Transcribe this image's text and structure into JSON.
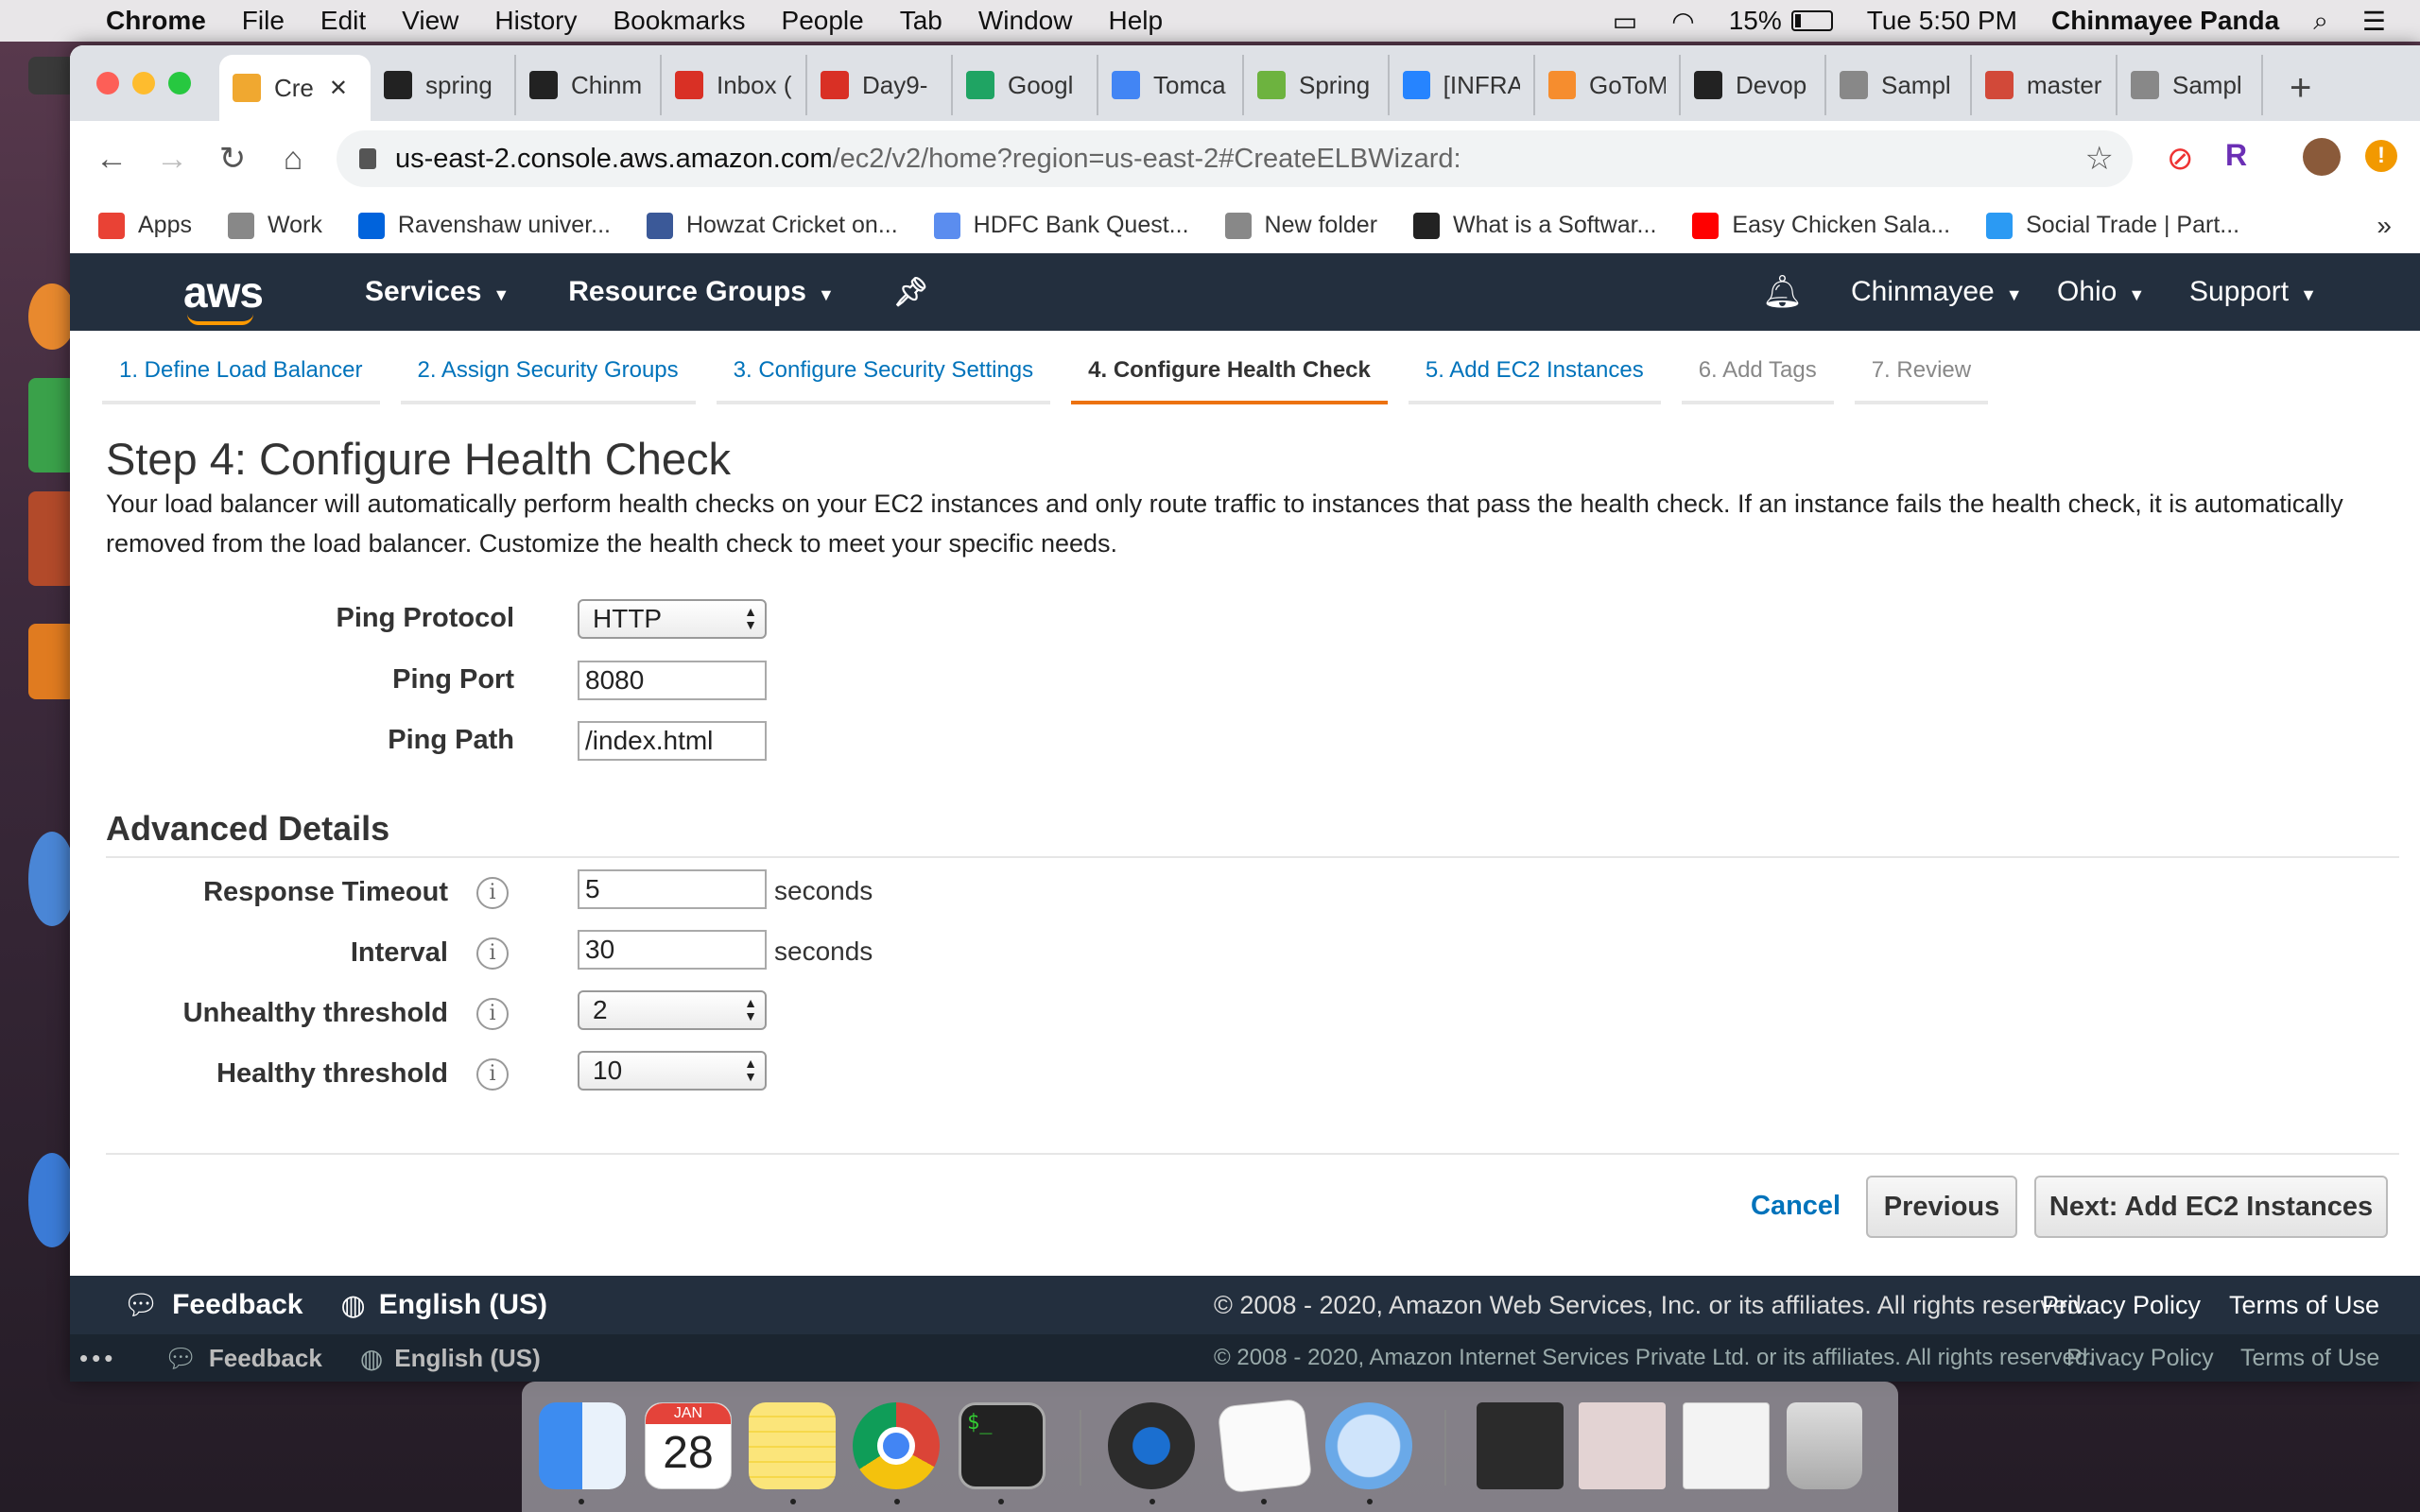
{
  "menubar": {
    "app": "Chrome",
    "items": [
      "File",
      "Edit",
      "View",
      "History",
      "Bookmarks",
      "People",
      "Tab",
      "Window",
      "Help"
    ],
    "battery": "15%",
    "clock": "Tue 5:50 PM",
    "user": "Chinmayee Panda"
  },
  "tabs": [
    {
      "label": "Cre",
      "icon": "aws-icon",
      "color": "#f0a830"
    },
    {
      "label": "spring",
      "icon": "github-icon",
      "color": "#222"
    },
    {
      "label": "Chinm",
      "icon": "github-icon",
      "color": "#222"
    },
    {
      "label": "Inbox (",
      "icon": "gmail-icon",
      "color": "#d93025"
    },
    {
      "label": "Day9-",
      "icon": "calendar-icon",
      "color": "#d93025"
    },
    {
      "label": "Googl",
      "icon": "drive-icon",
      "color": "#1fa463"
    },
    {
      "label": "Tomca",
      "icon": "docs-icon",
      "color": "#4285f4"
    },
    {
      "label": "Spring",
      "icon": "spring-icon",
      "color": "#6db33f"
    },
    {
      "label": "[INFRA",
      "icon": "jira-icon",
      "color": "#2684ff"
    },
    {
      "label": "GoToM",
      "icon": "gotomeeting-icon",
      "color": "#f68d2e"
    },
    {
      "label": "Devop",
      "icon": "github-icon",
      "color": "#222"
    },
    {
      "label": "Sampl",
      "icon": "jenkins-icon",
      "color": "#888"
    },
    {
      "label": "master",
      "icon": "jenkins-icon",
      "color": "#d24939"
    },
    {
      "label": "Sampl",
      "icon": "jenkins-icon",
      "color": "#888"
    }
  ],
  "address": {
    "host": "us-east-2.console.aws.amazon.com",
    "path": "/ec2/v2/home?region=us-east-2#CreateELBWizard:"
  },
  "bookmarks": [
    {
      "label": "Apps",
      "icon": "apps-grid-icon",
      "color": "#e94235"
    },
    {
      "label": "Work",
      "icon": "folder-icon",
      "color": "#888"
    },
    {
      "label": "Ravenshaw univer...",
      "icon": "flickr-icon",
      "color": "#0063dc"
    },
    {
      "label": "Howzat Cricket on...",
      "icon": "facebook-icon",
      "color": "#3b5998"
    },
    {
      "label": "HDFC Bank Quest...",
      "icon": "b-icon",
      "color": "#5b8def"
    },
    {
      "label": "New folder",
      "icon": "folder-icon",
      "color": "#888"
    },
    {
      "label": "What is a Softwar...",
      "icon": "bookmark-site-icon",
      "color": "#222"
    },
    {
      "label": "Easy Chicken Sala...",
      "icon": "youtube-icon",
      "color": "#ff0000"
    },
    {
      "label": "Social Trade | Part...",
      "icon": "s-icon",
      "color": "#2b9af3"
    }
  ],
  "aws": {
    "logo": "aws",
    "services": "Services",
    "resource_groups": "Resource Groups",
    "account": "Chinmayee",
    "region": "Ohio",
    "support": "Support"
  },
  "steps": [
    {
      "label": "1. Define Load Balancer",
      "state": "link"
    },
    {
      "label": "2. Assign Security Groups",
      "state": "link"
    },
    {
      "label": "3. Configure Security Settings",
      "state": "link"
    },
    {
      "label": "4. Configure Health Check",
      "state": "active"
    },
    {
      "label": "5. Add EC2 Instances",
      "state": "link"
    },
    {
      "label": "6. Add Tags",
      "state": "disabled"
    },
    {
      "label": "7. Review",
      "state": "disabled"
    }
  ],
  "page": {
    "title": "Step 4: Configure Health Check",
    "description": "Your load balancer will automatically perform health checks on your EC2 instances and only route traffic to instances that pass the health check. If an instance fails the health check, it is automatically removed from the load balancer. Customize the health check to meet your specific needs."
  },
  "form": {
    "ping_protocol_label": "Ping Protocol",
    "ping_protocol_value": "HTTP",
    "ping_port_label": "Ping Port",
    "ping_port_value": "8080",
    "ping_path_label": "Ping Path",
    "ping_path_value": "/index.html"
  },
  "advanced": {
    "heading": "Advanced Details",
    "response_timeout_label": "Response Timeout",
    "response_timeout_value": "5",
    "interval_label": "Interval",
    "interval_value": "30",
    "unhealthy_label": "Unhealthy threshold",
    "unhealthy_value": "2",
    "healthy_label": "Healthy threshold",
    "healthy_value": "10",
    "unit": "seconds",
    "info": "i"
  },
  "buttons": {
    "cancel": "Cancel",
    "previous": "Previous",
    "next": "Next: Add EC2 Instances"
  },
  "footer": {
    "feedback": "Feedback",
    "language": "English (US)",
    "copyright": "© 2008 - 2020, Amazon Web Services, Inc. or its affiliates. All rights reserved.",
    "privacy": "Privacy Policy",
    "terms": "Terms of Use"
  },
  "footer_behind": {
    "feedback": "Feedback",
    "language": "English (US)",
    "copyright": "© 2008 - 2020, Amazon Internet Services Private Ltd. or its affiliates. All rights reserved.",
    "privacy": "Privacy Policy",
    "terms": "Terms of Use"
  },
  "dock": {
    "calendar_month": "JAN",
    "calendar_day": "28",
    "apps": [
      "finder-icon",
      "calendar-icon",
      "notes-icon",
      "chrome-icon",
      "terminal-icon",
      "quicktime-icon",
      "textedit-icon",
      "keychain-icon",
      "downloads-stack-icon",
      "documents-stack-icon",
      "screenshots-stack-icon",
      "trash-icon"
    ]
  },
  "colors": {
    "aws_nav": "#232f3e",
    "aws_orange": "#ff9900",
    "link_blue": "#0073bb",
    "active_step": "#ec7211"
  }
}
